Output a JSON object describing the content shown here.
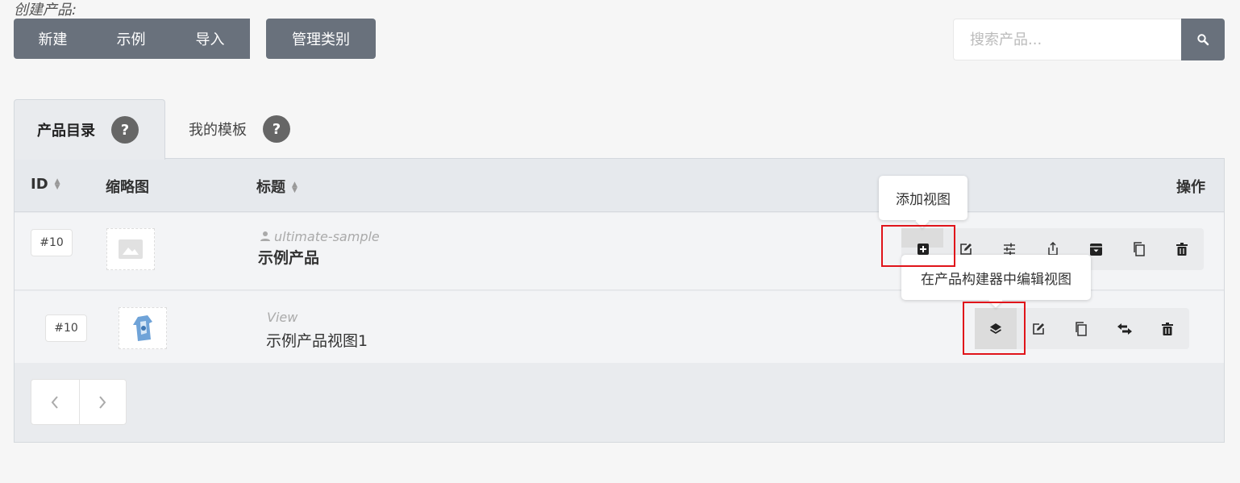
{
  "toolbar": {
    "create_label": "创建产品:",
    "new_label": "新建",
    "sample_label": "示例",
    "import_label": "导入",
    "manage_label": "管理类别",
    "search_placeholder": "搜索产品..."
  },
  "tabs": [
    {
      "label": "产品目录",
      "help": "?"
    },
    {
      "label": "我的模板",
      "help": "?"
    }
  ],
  "table": {
    "headers": {
      "id": "ID",
      "thumbnail": "缩略图",
      "title": "标题",
      "actions": "操作"
    },
    "rows": [
      {
        "id": "#10",
        "meta": "ultimate-sample",
        "title": "示例产品"
      },
      {
        "id": "#10",
        "meta": "View",
        "title": "示例产品视图1"
      }
    ]
  },
  "tooltips": {
    "add_view": "添加视图",
    "edit_in_builder": "在产品构建器中编辑视图"
  },
  "colors": {
    "button": "#69717c",
    "highlight": "#e0141a",
    "panel": "#e9ebee"
  }
}
